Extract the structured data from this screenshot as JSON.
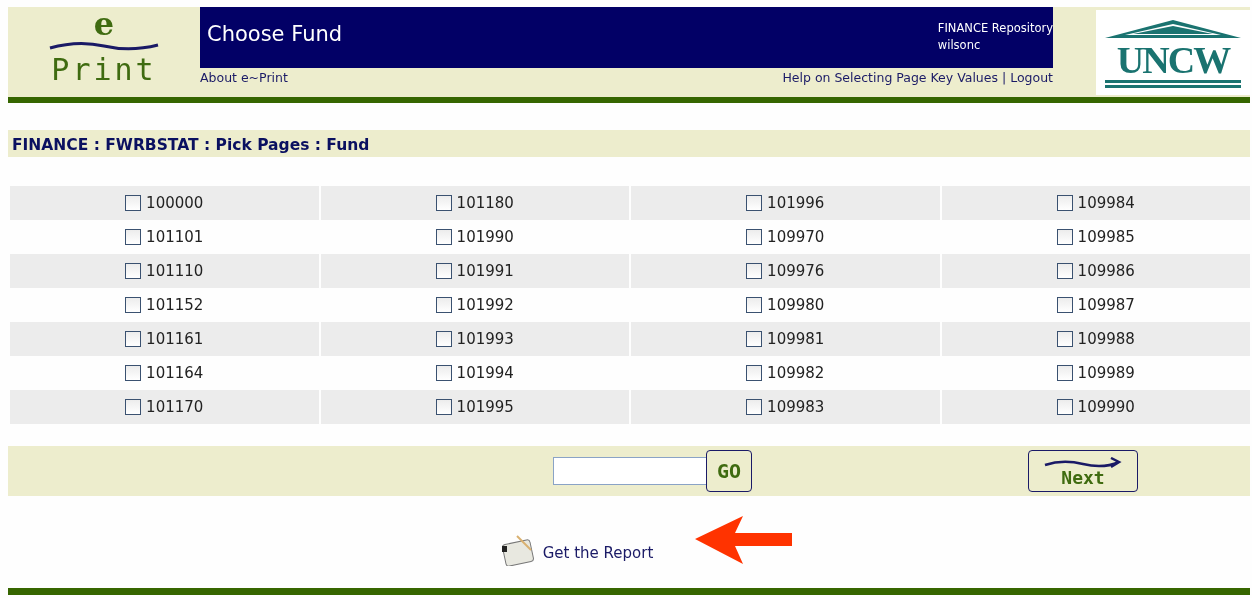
{
  "logo": {
    "letter": "e",
    "word": "Print"
  },
  "header": {
    "title": "Choose Fund",
    "repository": "FINANCE Repository",
    "user": "wilsonc",
    "about_link": "About e~Print",
    "help_link": "Help on Selecting Page Key Values",
    "separator": "|",
    "logout_link": "Logout"
  },
  "university_logo": {
    "text": "UNCW"
  },
  "breadcrumb": "FINANCE : FWRBSTAT : Pick Pages : Fund",
  "funds": [
    [
      {
        "label": "100000",
        "checked": false
      },
      {
        "label": "101180",
        "checked": false
      },
      {
        "label": "101996",
        "checked": false
      },
      {
        "label": "109984",
        "checked": false
      }
    ],
    [
      {
        "label": "101101",
        "checked": false
      },
      {
        "label": "101990",
        "checked": false
      },
      {
        "label": "109970",
        "checked": false
      },
      {
        "label": "109985",
        "checked": false
      }
    ],
    [
      {
        "label": "101110",
        "checked": false
      },
      {
        "label": "101991",
        "checked": false
      },
      {
        "label": "109976",
        "checked": false
      },
      {
        "label": "109986",
        "checked": false
      }
    ],
    [
      {
        "label": "101152",
        "checked": false
      },
      {
        "label": "101992",
        "checked": false
      },
      {
        "label": "109980",
        "checked": false
      },
      {
        "label": "109987",
        "checked": false
      }
    ],
    [
      {
        "label": "101161",
        "checked": false
      },
      {
        "label": "101993",
        "checked": false
      },
      {
        "label": "109981",
        "checked": false
      },
      {
        "label": "109988",
        "checked": false
      }
    ],
    [
      {
        "label": "101164",
        "checked": false
      },
      {
        "label": "101994",
        "checked": false
      },
      {
        "label": "109982",
        "checked": false
      },
      {
        "label": "109989",
        "checked": false
      }
    ],
    [
      {
        "label": "101170",
        "checked": false
      },
      {
        "label": "101995",
        "checked": false
      },
      {
        "label": "109983",
        "checked": false
      },
      {
        "label": "109990",
        "checked": false
      }
    ]
  ],
  "toolbar": {
    "go_button": "GO",
    "next_button": "Next"
  },
  "report_link": "Get the Report"
}
